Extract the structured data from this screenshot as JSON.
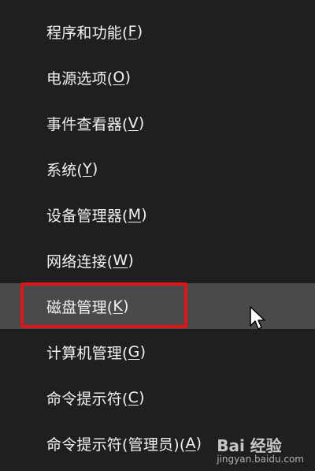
{
  "menu": {
    "items": [
      {
        "label": "程序和功能(",
        "key": "F",
        "suffix": ")"
      },
      {
        "label": "电源选项(",
        "key": "O",
        "suffix": ")"
      },
      {
        "label": "事件查看器(",
        "key": "V",
        "suffix": ")"
      },
      {
        "label": "系统(",
        "key": "Y",
        "suffix": ")"
      },
      {
        "label": "设备管理器(",
        "key": "M",
        "suffix": ")"
      },
      {
        "label": "网络连接(",
        "key": "W",
        "suffix": ")"
      },
      {
        "label": "磁盘管理(",
        "key": "K",
        "suffix": ")"
      },
      {
        "label": "计算机管理(",
        "key": "G",
        "suffix": ")"
      },
      {
        "label": "命令提示符(",
        "key": "C",
        "suffix": ")"
      },
      {
        "label": "命令提示符(管理员)(",
        "key": "A",
        "suffix": ")"
      }
    ],
    "hovered_index": 6
  },
  "watermark": {
    "brand": "Bai 经验",
    "url": "jingyan.baidu.com"
  },
  "colors": {
    "menu_bg": "#1f1f1f",
    "hover_bg": "#4a4a4a",
    "highlight_border": "#e0151a",
    "text": "#f2f2f2"
  }
}
